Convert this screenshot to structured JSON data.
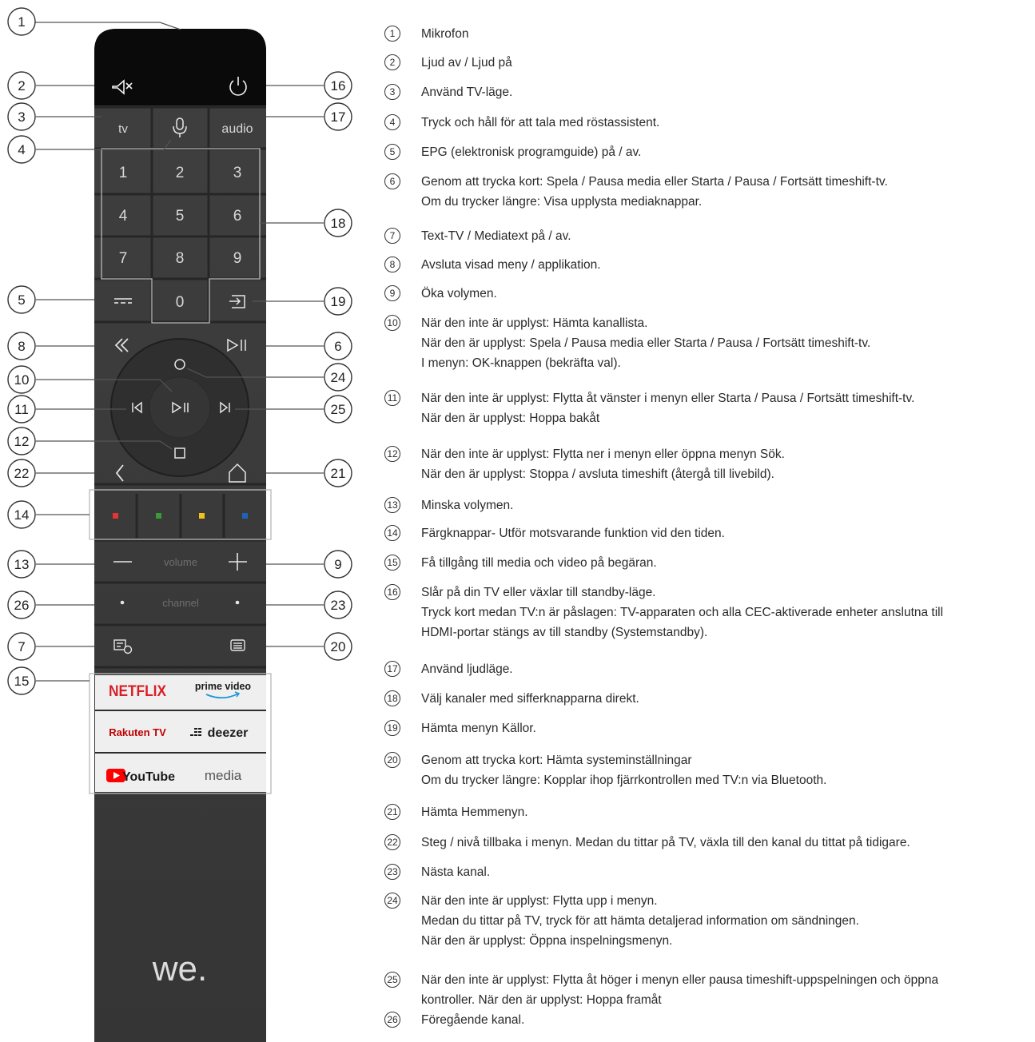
{
  "remote": {
    "keys": {
      "tv": "tv",
      "audio": "audio",
      "digits": [
        "1",
        "2",
        "3",
        "4",
        "5",
        "6",
        "7",
        "8",
        "9",
        "0"
      ],
      "volume": "volume",
      "channel": "channel"
    },
    "logos": {
      "netflix": "NETFLIX",
      "prime": "prime video",
      "rakuten": "Rakuten TV",
      "deezer": "deezer",
      "youtube": "YouTube",
      "media": "media"
    },
    "brand": "we."
  },
  "callouts": [
    "1",
    "2",
    "3",
    "4",
    "5",
    "6",
    "7",
    "8",
    "9",
    "10",
    "11",
    "12",
    "13",
    "14",
    "15",
    "16",
    "17",
    "18",
    "19",
    "20",
    "21",
    "22",
    "23",
    "24",
    "25",
    "26"
  ],
  "legend": [
    {
      "num": "1",
      "lines": [
        "Mikrofon"
      ]
    },
    {
      "num": "2",
      "lines": [
        "Ljud av / Ljud på"
      ]
    },
    {
      "num": "3",
      "lines": [
        "Använd TV-läge."
      ]
    },
    {
      "num": "4",
      "lines": [
        "Tryck och håll för att tala med röstassistent."
      ]
    },
    {
      "num": "5",
      "lines": [
        "EPG (elektronisk programguide) på / av."
      ]
    },
    {
      "num": "6",
      "lines": [
        "Genom att trycka kort: Spela / Pausa media eller Starta / Pausa / Fortsätt timeshift-tv.",
        "Om du trycker längre: Visa upplysta mediaknappar."
      ]
    },
    {
      "num": "7",
      "lines": [
        "Text-TV / Mediatext på / av."
      ]
    },
    {
      "num": "8",
      "lines": [
        "Avsluta visad meny / applikation."
      ]
    },
    {
      "num": "9",
      "lines": [
        "Öka volymen."
      ]
    },
    {
      "num": "10",
      "lines": [
        "När den inte är upplyst: Hämta kanallista.",
        "När den är upplyst: Spela / Pausa media eller Starta / Pausa / Fortsätt timeshift-tv.",
        "I menyn: OK-knappen (bekräfta val)."
      ]
    },
    {
      "num": "11",
      "lines": [
        "När den inte är upplyst: Flytta åt vänster i menyn eller Starta / Pausa / Fortsätt timeshift-tv.",
        "När den är upplyst: Hoppa bakåt"
      ]
    },
    {
      "num": "12",
      "lines": [
        "När den inte är upplyst: Flytta ner i menyn eller öppna menyn Sök.",
        "När den är upplyst: Stoppa / avsluta timeshift (återgå till livebild)."
      ]
    },
    {
      "num": "13",
      "lines": [
        "Minska volymen."
      ]
    },
    {
      "num": "14",
      "lines": [
        "Färgknappar- Utför motsvarande funktion vid den tiden."
      ]
    },
    {
      "num": "15",
      "lines": [
        "Få tillgång till media och video på begäran."
      ]
    },
    {
      "num": "16",
      "lines": [
        "Slår på din TV eller växlar till standby-läge.",
        "Tryck kort medan TV:n är påslagen: TV-apparaten och alla CEC-aktiverade enheter anslutna till",
        "HDMI-portar stängs av till standby (Systemstandby)."
      ]
    },
    {
      "num": "17",
      "lines": [
        "Använd ljudläge."
      ]
    },
    {
      "num": "18",
      "lines": [
        "Välj kanaler med sifferknapparna direkt."
      ]
    },
    {
      "num": "19",
      "lines": [
        "Hämta menyn Källor."
      ]
    },
    {
      "num": "20",
      "lines": [
        "Genom att trycka kort: Hämta systeminställningar",
        "Om du trycker längre: Kopplar ihop fjärrkontrollen med TV:n via Bluetooth."
      ]
    },
    {
      "num": "21",
      "lines": [
        "Hämta Hemmenyn."
      ]
    },
    {
      "num": "22",
      "lines": [
        "Steg / nivå tillbaka i menyn. Medan du tittar på TV, växla till den kanal du tittat på tidigare."
      ]
    },
    {
      "num": "23",
      "lines": [
        "Nästa kanal."
      ]
    },
    {
      "num": "24",
      "lines": [
        "När den inte är upplyst: Flytta upp i menyn.",
        "Medan du tittar på TV, tryck för att hämta detaljerad information om sändningen.",
        "När den är upplyst: Öppna inspelningsmenyn."
      ]
    },
    {
      "num": "25",
      "lines": [
        "När den inte är upplyst: Flytta åt höger i menyn eller pausa timeshift-uppspelningen och öppna",
        "kontroller. När den är upplyst: Hoppa framåt"
      ]
    },
    {
      "num": "26",
      "lines": [
        "Föregående kanal."
      ]
    }
  ],
  "colors": {
    "red": "#e63333",
    "green": "#3a9a3a",
    "yellow": "#f2c21b",
    "blue": "#1e63b8",
    "body": "#3b3b3b",
    "top": "#0a0a0a"
  }
}
